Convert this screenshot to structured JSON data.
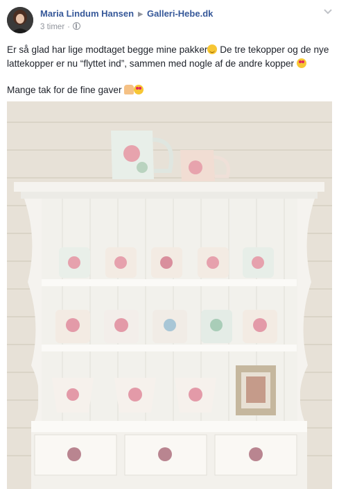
{
  "post": {
    "author": "Maria Lindum Hansen",
    "target_page": "Galleri-Hebe.dk",
    "timestamp": "3 timer",
    "audience_icon": "globe-icon",
    "options_icon": "chevron-down-icon",
    "text_line1": "Er så glad har lige modtaget begge mine pakker",
    "text_line1_b": " De tre tekopper og de nye lattekopper er nu “flyttet ind”, sammen med nogle af de andre kopper ",
    "text_line2": "Mange tak for de fine gaver",
    "emoji_1": "hugging-face-emoji",
    "emoji_2": "heart-eyes-emoji",
    "emoji_3": "praying-hands-emoji",
    "emoji_4": "heart-eyes-emoji"
  },
  "colors": {
    "link": "#365899",
    "meta": "#90949c",
    "text": "#1d2129"
  }
}
